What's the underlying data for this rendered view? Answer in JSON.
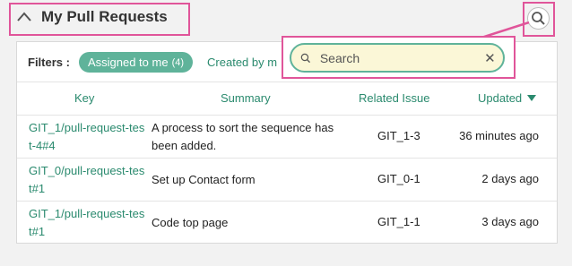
{
  "header": {
    "title": "My Pull Requests",
    "collapse_icon": "chevron-up-icon",
    "search_icon": "search-icon"
  },
  "filters": {
    "label": "Filters :",
    "chip_label": "Assigned to me",
    "chip_count": "(4)",
    "created_by_label": "Created by m"
  },
  "search": {
    "placeholder": "Search",
    "value": "",
    "clear_icon": "close-icon"
  },
  "table": {
    "columns": [
      "Key",
      "Summary",
      "Related Issue",
      "Updated"
    ],
    "rows": [
      {
        "key": "GIT_1/pull-request-test-4#4",
        "summary": "A process to sort the sequence has been added.",
        "issue": "GIT_1-3",
        "updated": "36 minutes ago"
      },
      {
        "key": "GIT_0/pull-request-test#1",
        "summary": "Set up Contact form",
        "issue": "GIT_0-1",
        "updated": "2 days ago"
      },
      {
        "key": "GIT_1/pull-request-test#1",
        "summary": "Code top page",
        "issue": "GIT_1-1",
        "updated": "3 days ago"
      }
    ]
  },
  "colors": {
    "accent": "#2a8a6e",
    "chip_bg": "#5fb39a",
    "highlight": "#e0559a",
    "search_bg": "#fbf7d7"
  }
}
